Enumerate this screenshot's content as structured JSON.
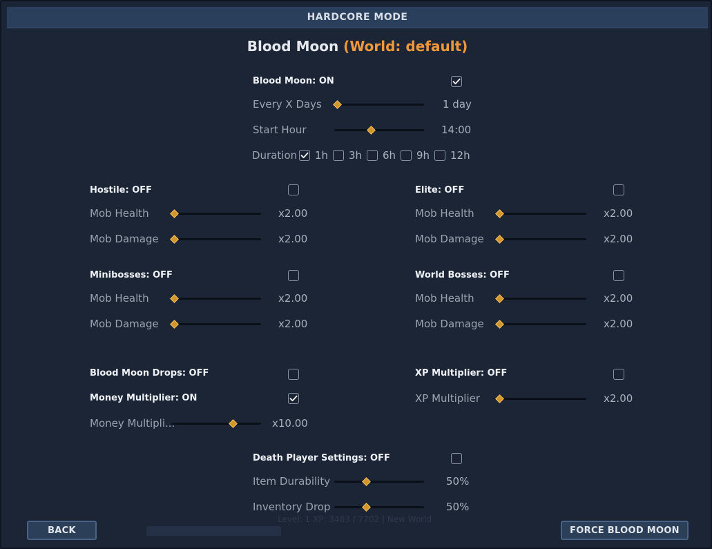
{
  "window": {
    "title": "HARDCORE MODE"
  },
  "page": {
    "title": "Blood Moon",
    "title_suffix": "(World: default)"
  },
  "blood_moon": {
    "label": "Blood Moon: ON",
    "checked": true,
    "every_x_days": {
      "label": "Every X Days",
      "value": "1 day",
      "level": 0.0
    },
    "start_hour": {
      "label": "Start Hour",
      "value": "14:00",
      "level": 0.58
    },
    "duration": {
      "label": "Duration",
      "options": [
        {
          "label": "1h",
          "checked": true
        },
        {
          "label": "3h",
          "checked": false
        },
        {
          "label": "6h",
          "checked": false
        },
        {
          "label": "9h",
          "checked": false
        },
        {
          "label": "12h",
          "checked": false
        }
      ]
    }
  },
  "hostile": {
    "label": "Hostile: OFF",
    "checked": false,
    "mob_health": {
      "label": "Mob Health",
      "value": "x2.00",
      "level": 0.0
    },
    "mob_damage": {
      "label": "Mob Damage",
      "value": "x2.00",
      "level": 0.0
    }
  },
  "elite": {
    "label": "Elite: OFF",
    "checked": false,
    "mob_health": {
      "label": "Mob Health",
      "value": "x2.00",
      "level": 0.0
    },
    "mob_damage": {
      "label": "Mob Damage",
      "value": "x2.00",
      "level": 0.0
    }
  },
  "minibosses": {
    "label": "Minibosses: OFF",
    "checked": false,
    "mob_health": {
      "label": "Mob Health",
      "value": "x2.00",
      "level": 0.0
    },
    "mob_damage": {
      "label": "Mob Damage",
      "value": "x2.00",
      "level": 0.0
    }
  },
  "world_bosses": {
    "label": "World Bosses: OFF",
    "checked": false,
    "mob_health": {
      "label": "Mob Health",
      "value": "x2.00",
      "level": 0.0
    },
    "mob_damage": {
      "label": "Mob Damage",
      "value": "x2.00",
      "level": 0.0
    }
  },
  "drops": {
    "label": "Blood Moon Drops: OFF",
    "checked": false
  },
  "money": {
    "label": "Money Multiplier: ON",
    "checked": true,
    "slider": {
      "label": "Money Multipli...",
      "value": "x10.00",
      "level": 1.0
    }
  },
  "xp": {
    "label": "XP Multiplier: OFF",
    "checked": false,
    "slider": {
      "label": "XP Multiplier",
      "value": "x2.00",
      "level": 0.0
    }
  },
  "death": {
    "label": "Death Player Settings: OFF",
    "checked": false,
    "item_durability": {
      "label": "Item Durability",
      "value": "50%",
      "level": 0.5
    },
    "inventory_drop": {
      "label": "Inventory Drop",
      "value": "50%",
      "level": 0.5
    }
  },
  "background_text": "Level: 1 XP: 3483 / 7702 | New World",
  "buttons": {
    "back": "BACK",
    "force": "FORCE BLOOD MOON"
  },
  "colors": {
    "accent": "#f0983a",
    "thumb": "#d3962a",
    "panel": "#1c2536"
  }
}
